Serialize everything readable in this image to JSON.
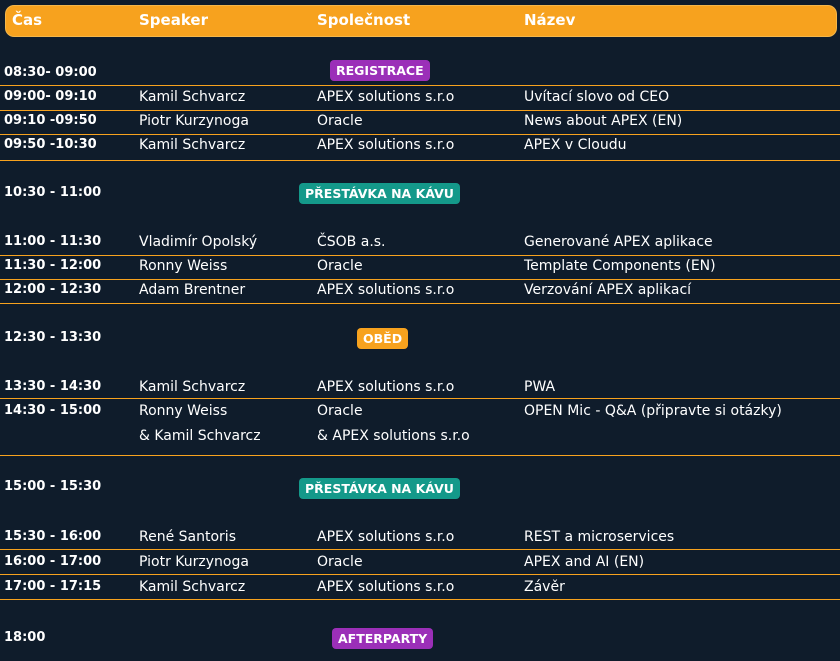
{
  "header": {
    "col_time": "Čas",
    "col_speaker": "Speaker",
    "col_company": "Společnost",
    "col_title": "Název"
  },
  "colors": {
    "accent": "#f7a21e",
    "purple": "#9b2fb8",
    "teal": "#14998a",
    "orange": "#f7a21e",
    "bg": "#0f1c2b"
  },
  "rows": [
    {
      "time": "08:30- 09:00",
      "badge": "REGISTRACE"
    },
    {
      "time": "09:00- 09:10",
      "speaker": "Kamil Schvarcz",
      "company": "APEX solutions s.r.o",
      "title": "Uvítací slovo od CEO"
    },
    {
      "time": "09:10 -09:50",
      "speaker": "Piotr Kurzynoga",
      "company": "Oracle",
      "title": "News about APEX (EN)"
    },
    {
      "time": "09:50 -10:30",
      "speaker": "Kamil Schvarcz",
      "company": "APEX solutions s.r.o",
      "title": "APEX v Cloudu"
    },
    {
      "time": "10:30 - 11:00",
      "badge": "PŘESTÁVKA NA KÁVU"
    },
    {
      "time": "11:00 - 11:30",
      "speaker": "Vladimír Opolský",
      "company": "ČSOB a.s.",
      "title": "Generované APEX aplikace"
    },
    {
      "time": "11:30 - 12:00",
      "speaker": "Ronny Weiss",
      "company": "Oracle",
      "title": "Template Components (EN)"
    },
    {
      "time": "12:00 - 12:30",
      "speaker": "Adam Brentner",
      "company": "APEX solutions s.r.o",
      "title": "Verzování APEX aplikací"
    },
    {
      "time": "12:30 - 13:30",
      "badge": "OBĚD"
    },
    {
      "time": "13:30 - 14:30",
      "speaker": "Kamil Schvarcz",
      "company": "APEX solutions s.r.o",
      "title": "PWA"
    },
    {
      "time": "14:30 - 15:00",
      "speaker": "Ronny Weiss",
      "company": "Oracle",
      "title": "OPEN Mic - Q&A (připravte si otázky)",
      "speaker2": "& Kamil Schvarcz",
      "company2": "& APEX solutions s.r.o"
    },
    {
      "time": "15:00 - 15:30",
      "badge": "PŘESTÁVKA NA KÁVU"
    },
    {
      "time": "15:30 - 16:00",
      "speaker": "René Santoris",
      "company": "APEX solutions s.r.o",
      "title": "REST a microservices"
    },
    {
      "time": "16:00 - 17:00",
      "speaker": "Piotr Kurzynoga",
      "company": "Oracle",
      "title": "APEX and AI (EN)"
    },
    {
      "time": "17:00 - 17:15",
      "speaker": "Kamil Schvarcz",
      "company": "APEX solutions s.r.o",
      "title": "Závěr"
    },
    {
      "time": "18:00",
      "badge": "AFTERPARTY"
    }
  ]
}
